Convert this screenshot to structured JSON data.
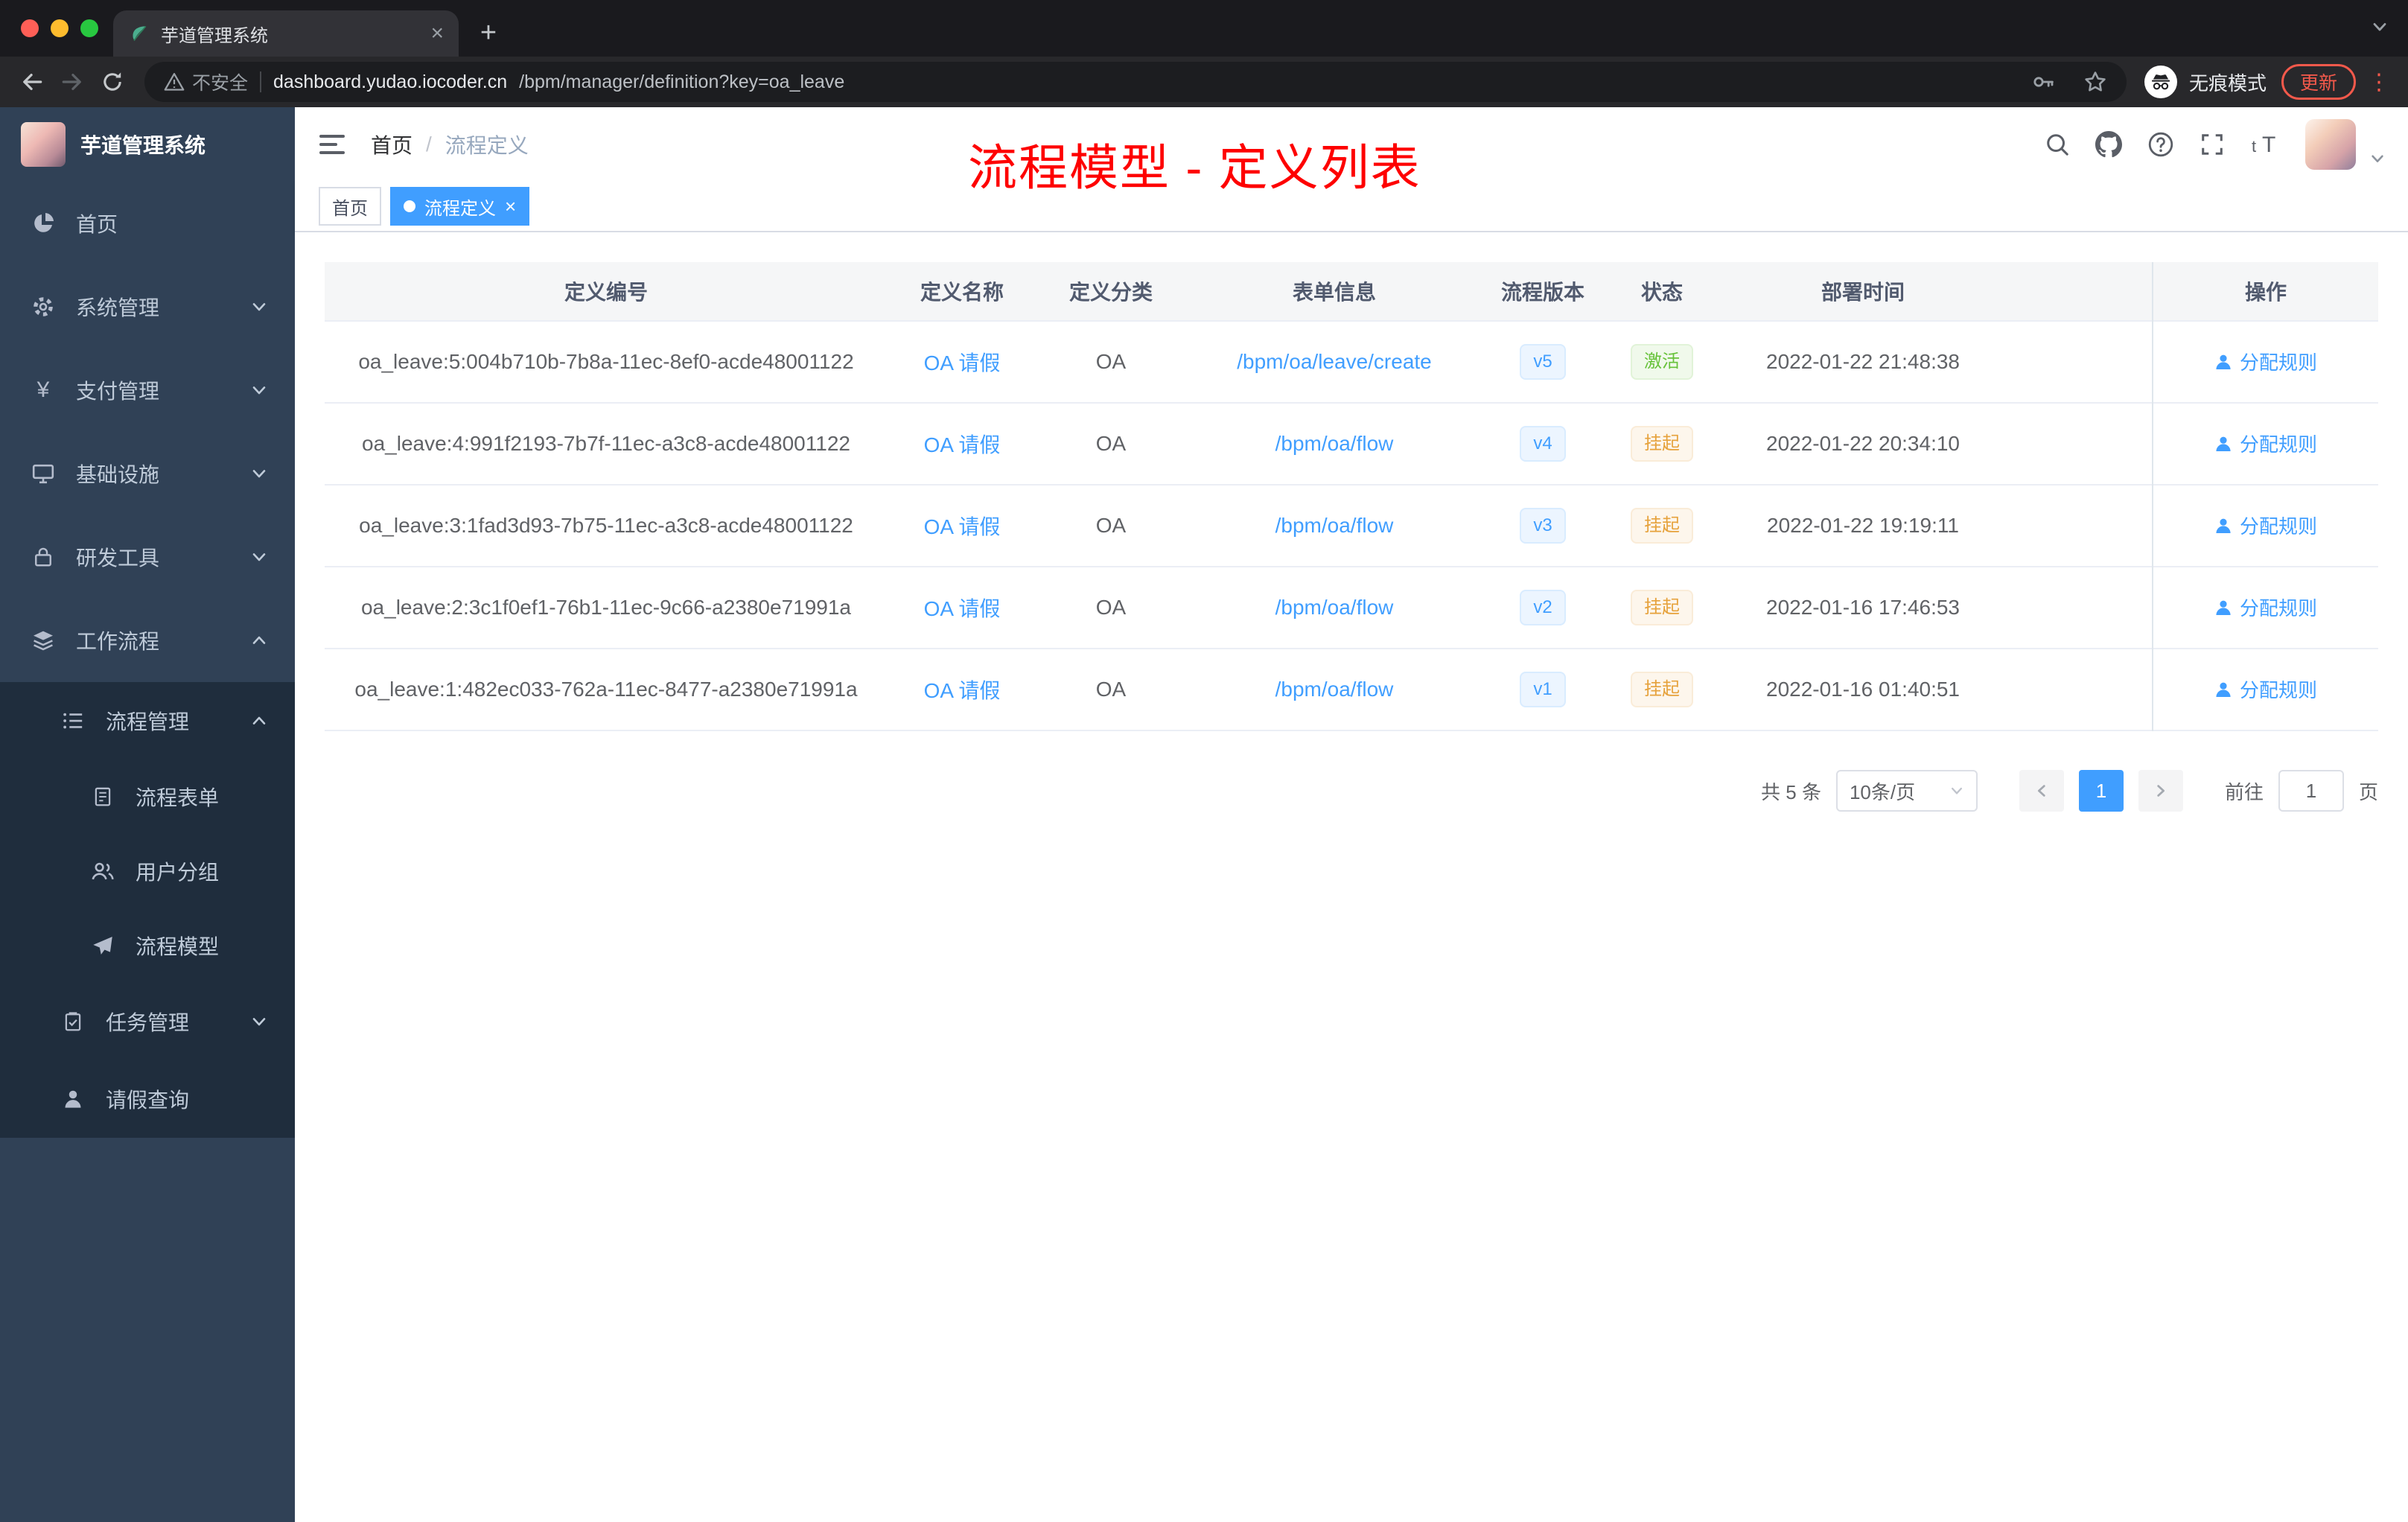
{
  "browser": {
    "tab_title": "芋道管理系统",
    "security_label": "不安全",
    "url_domain": "dashboard.yudao.iocoder.cn",
    "url_path": "/bpm/manager/definition?key=oa_leave",
    "incognito_label": "无痕模式",
    "update_label": "更新"
  },
  "glyphs": {
    "close": "×",
    "plus": "+",
    "kebab": "⋮",
    "yen": "¥",
    "font_small": "t",
    "font_large": "T"
  },
  "sidebar": {
    "logo_title": "芋道管理系统",
    "items": [
      {
        "label": "首页"
      },
      {
        "label": "系统管理"
      },
      {
        "label": "支付管理"
      },
      {
        "label": "基础设施"
      },
      {
        "label": "研发工具"
      },
      {
        "label": "工作流程"
      },
      {
        "label": "流程管理"
      },
      {
        "label": "流程表单"
      },
      {
        "label": "用户分组"
      },
      {
        "label": "流程模型"
      },
      {
        "label": "任务管理"
      },
      {
        "label": "请假查询"
      }
    ]
  },
  "navbar": {
    "breadcrumb_home": "首页",
    "breadcrumb_separator": "/",
    "breadcrumb_current": "流程定义",
    "annotation": "流程模型 - 定义列表"
  },
  "tags": [
    {
      "label": "首页",
      "active": false
    },
    {
      "label": "流程定义",
      "active": true
    }
  ],
  "table": {
    "columns": [
      "定义编号",
      "定义名称",
      "定义分类",
      "表单信息",
      "流程版本",
      "状态",
      "部署时间",
      "操作"
    ],
    "rows": [
      {
        "id": "oa_leave:5:004b710b-7b8a-11ec-8ef0-acde48001122",
        "name": "OA 请假",
        "category": "OA",
        "form": "/bpm/oa/leave/create",
        "version": "v5",
        "status": "激活",
        "time": "2022-01-22 21:48:38",
        "action": "分配规则"
      },
      {
        "id": "oa_leave:4:991f2193-7b7f-11ec-a3c8-acde48001122",
        "name": "OA 请假",
        "category": "OA",
        "form": "/bpm/oa/flow",
        "version": "v4",
        "status": "挂起",
        "time": "2022-01-22 20:34:10",
        "action": "分配规则"
      },
      {
        "id": "oa_leave:3:1fad3d93-7b75-11ec-a3c8-acde48001122",
        "name": "OA 请假",
        "category": "OA",
        "form": "/bpm/oa/flow",
        "version": "v3",
        "status": "挂起",
        "time": "2022-01-22 19:19:11",
        "action": "分配规则"
      },
      {
        "id": "oa_leave:2:3c1f0ef1-76b1-11ec-9c66-a2380e71991a",
        "name": "OA 请假",
        "category": "OA",
        "form": "/bpm/oa/flow",
        "version": "v2",
        "status": "挂起",
        "time": "2022-01-16 17:46:53",
        "action": "分配规则"
      },
      {
        "id": "oa_leave:1:482ec033-762a-11ec-8477-a2380e71991a",
        "name": "OA 请假",
        "category": "OA",
        "form": "/bpm/oa/flow",
        "version": "v1",
        "status": "挂起",
        "time": "2022-01-16 01:40:51",
        "action": "分配规则"
      }
    ]
  },
  "pagination": {
    "total": "共 5 条",
    "page_size": "10条/页",
    "current_page": "1",
    "goto_label": "前往",
    "goto_value": "1",
    "page_unit": "页"
  },
  "colors": {
    "accent": "#409EFF",
    "success": "#67C23A",
    "warning": "#E6A23C",
    "annotation_red": "#FE0000",
    "sidebar_bg": "#304156",
    "sidebar_submenu_bg": "#1F2D3D"
  }
}
